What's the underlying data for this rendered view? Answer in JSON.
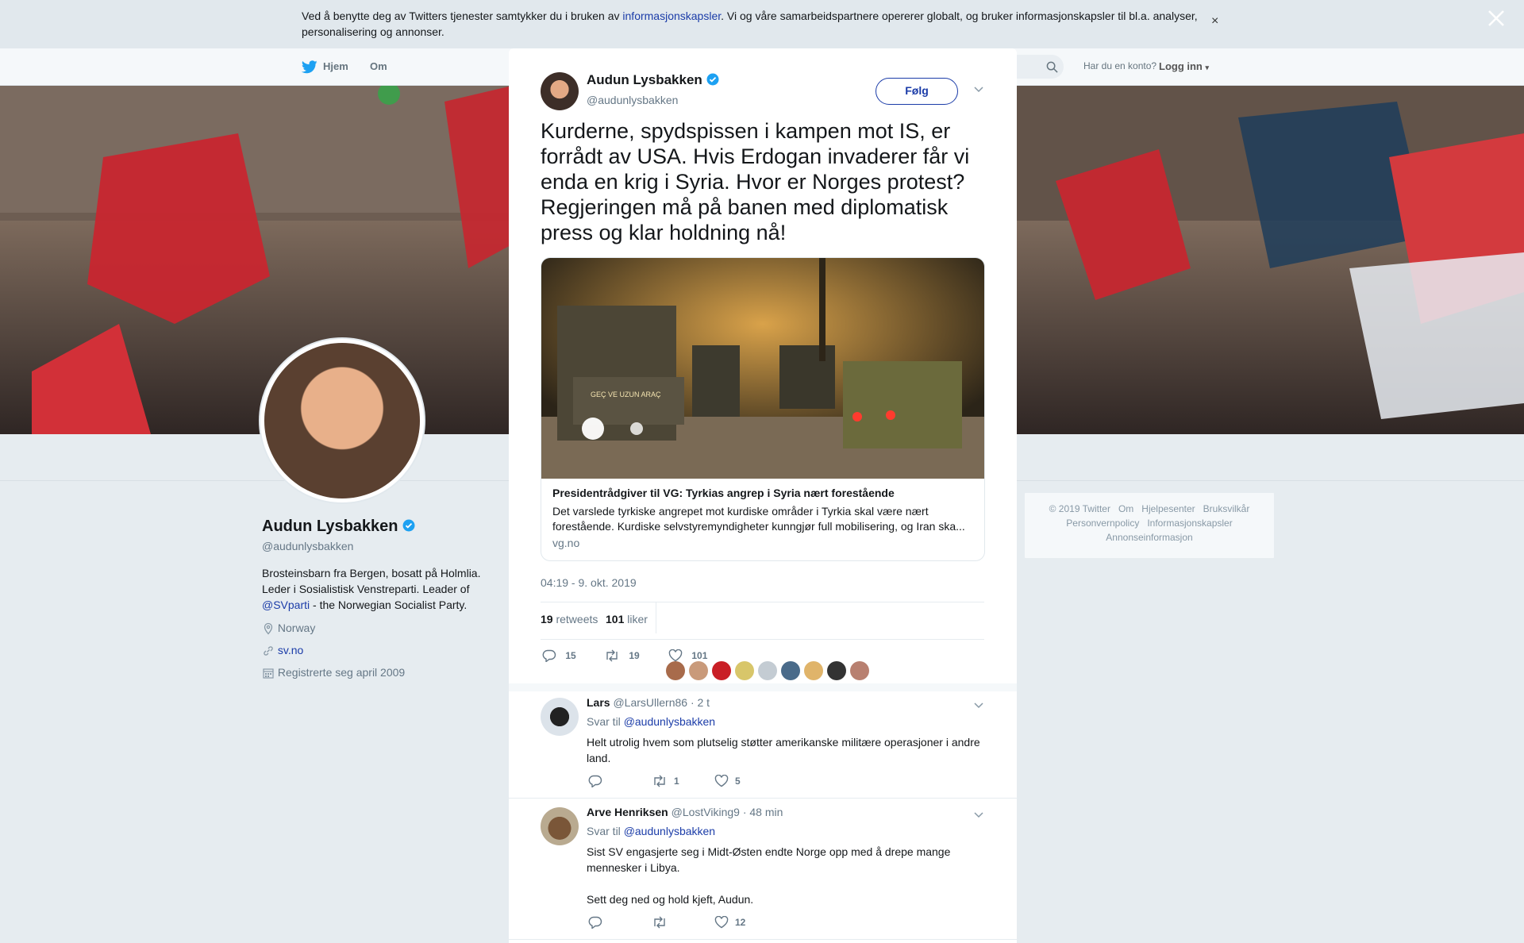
{
  "cookie": {
    "pre": "Ved å benytte deg av Twitters tjenester samtykker du i bruken av ",
    "link": "informasjonskapsler",
    "post": ". Vi og våre samarbeidspartnere opererer globalt, og bruker informasjonskapsler til bl.a. analyser, personalisering og annonser.",
    "close": "×"
  },
  "topnav": {
    "home": "Hjem",
    "about": "Om",
    "have_account": "Har du en konto?",
    "login": "Logg inn"
  },
  "profile": {
    "name": "Audun Lysbakken",
    "handle": "@audunlysbakken",
    "bio_1": "Brosteinsbarn fra Bergen, bosatt på Holmlia.",
    "bio_2": "Leder i Sosialistisk Venstreparti. Leader of",
    "bio_link": "@SVparti",
    "bio_3": " - the Norwegian Socialist Party.",
    "location": "Norway",
    "website": "sv.no",
    "joined": "Registrerte seg april 2009"
  },
  "footer": {
    "items": [
      "© 2019 Twitter",
      "Om",
      "Hjelpesenter",
      "Bruksvilkår",
      "Personvernpolicy",
      "Informasjonskapsler",
      "Annonseinformasjon"
    ]
  },
  "tweet": {
    "author": "Audun Lysbakken",
    "handle": "@audunlysbakken",
    "follow": "Følg",
    "text": "Kurderne, spydspissen i kampen mot IS, er forrådt av USA. Hvis Erdogan invaderer får vi enda en krig i Syria. Hvor er Norges protest? Regjeringen må på banen med diplomatisk press og klar holdning nå!",
    "card_title": "Presidentrådgiver til VG: Tyrkias angrep i Syria nært forestående",
    "card_desc": "Det varslede tyrkiske angrepet mot kurdiske områder i Tyrkia skal være nært forestående. Kurdiske selvstyremyndigheter kunngjør full mobilisering, og Iran ska...",
    "card_domain": "vg.no",
    "card_image_text": "GEÇ VE UZUN ARAÇ",
    "timestamp": "04:19 - 9. okt. 2019",
    "retweets": "19",
    "retweets_label": "retweets",
    "likes": "101",
    "likes_label": "liker",
    "actions": {
      "replies": "15",
      "retweets": "19",
      "likes": "101"
    }
  },
  "replies": [
    {
      "name": "Lars",
      "handle": "@LarsUllern86",
      "time": "· 2 t",
      "reply_to_label": "Svar til",
      "reply_to": "@audunlysbakken",
      "text": "Helt utrolig hvem som plutselig støtter amerikanske militære operasjoner i andre land.",
      "retweets": "1",
      "likes": "5"
    },
    {
      "name": "Arve Henriksen",
      "handle": "@LostViking9",
      "time": "· 48 min",
      "reply_to_label": "Svar til",
      "reply_to": "@audunlysbakken",
      "text_1": "Sist SV engasjerte seg i Midt-Østen endte Norge opp med å drepe mange mennesker i Libya.",
      "text_2": "Sett deg ned og hold kjeft, Audun.",
      "likes": "12"
    }
  ],
  "colors": {
    "accent": "#1da1f2",
    "link": "#1b3ca8",
    "verified": "#1da1f2",
    "like": "#e0245e"
  },
  "icons": [
    "close-icon",
    "twitter-bird-icon",
    "search-icon",
    "verified-icon",
    "chevron-down-icon",
    "location-icon",
    "link-icon",
    "calendar-icon",
    "reply-icon",
    "retweet-icon",
    "like-icon"
  ]
}
